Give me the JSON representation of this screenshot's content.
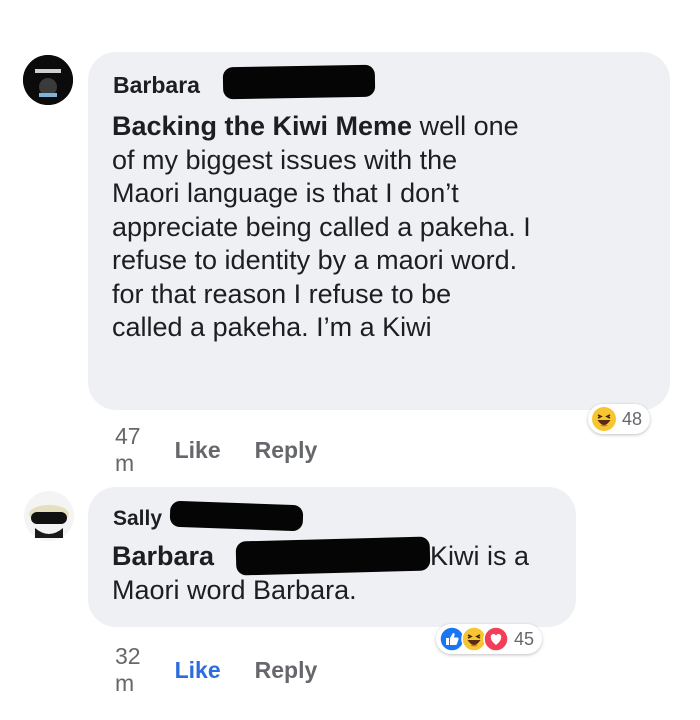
{
  "comments": [
    {
      "author": "Barbara",
      "mention": "Backing the Kiwi Meme",
      "text_lines": [
        " well one",
        "of my biggest issues with the",
        "Maori language is that I don’t",
        "appreciate being called a pakeha. I",
        "refuse to identity by a maori word.",
        "for that reason I refuse to be",
        "called a pakeha. I’m a Kiwi"
      ],
      "time": "47 m",
      "like_label": "Like",
      "reply_label": "Reply",
      "reactions": {
        "icons": [
          "haha-icon"
        ],
        "count": "48"
      }
    },
    {
      "author": "Sally",
      "mention": "Barbara",
      "text_lines": [
        "Kiwi is a",
        "Maori word Barbara."
      ],
      "time": "32 m",
      "like_label": "Like",
      "reply_label": "Reply",
      "reactions": {
        "icons": [
          "like-icon",
          "haha-icon",
          "love-icon"
        ],
        "count": "45"
      }
    }
  ],
  "colors": {
    "bubble": "#eef0f3",
    "link_blue": "#2d6cdf",
    "meta_gray": "#65676b",
    "like_blue": "#1877f2",
    "haha_yellow": "#f7c531",
    "love_red": "#f33e58"
  }
}
